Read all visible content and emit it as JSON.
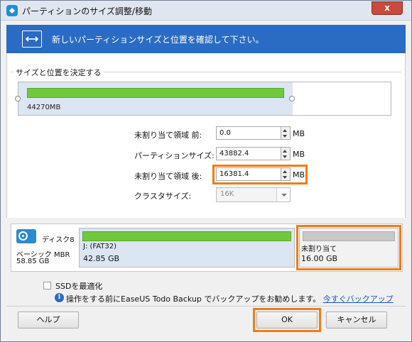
{
  "window": {
    "title": "パーティションのサイズ調整/移動",
    "close_label": "x"
  },
  "banner": {
    "text": "新しいパーティションサイズと位置を確認して下さい。"
  },
  "group": {
    "label": "サイズと位置を決定する"
  },
  "disk_bar": {
    "size_label": "44270MB"
  },
  "fields": {
    "unalloc_before": {
      "label": "未割り当て領域 前:",
      "value": "0.0",
      "unit": "MB"
    },
    "partition_size": {
      "label": "パーティションサイズ:",
      "value": "43882.4",
      "unit": "MB"
    },
    "unalloc_after": {
      "label": "未割り当て領域 後:",
      "value": "16381.4",
      "unit": "MB"
    },
    "cluster_size": {
      "label": "クラスタサイズ:",
      "value": "16K"
    }
  },
  "disk_map": {
    "disk_name": "ディスク8",
    "disk_type": "ベーシック MBR",
    "disk_capacity": "58.85 GB",
    "partition": {
      "name": "J: (FAT32)",
      "size": "42.85 GB"
    },
    "unallocated": {
      "name": "未割り当て",
      "size": "16.00 GB"
    }
  },
  "options": {
    "ssd_label": "SSDを最適化",
    "info_text": "操作をする前にEaseUS Todo Backup でバックアップをお勧めします。",
    "backup_link": "今すぐバックアップ"
  },
  "buttons": {
    "help": "ヘルプ",
    "ok": "OK",
    "cancel": "キャンセル"
  },
  "colors": {
    "accent": "#2a6bc4",
    "partition_green": "#72c83c",
    "highlight": "#f07c18"
  }
}
